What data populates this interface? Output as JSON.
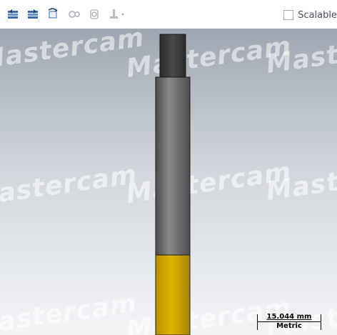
{
  "toolbar": {
    "buttons": [
      {
        "icon": "stack-left-icon"
      },
      {
        "icon": "stack-right-icon"
      },
      {
        "icon": "rotate-view-icon"
      },
      {
        "icon": "gear-pair-icon"
      },
      {
        "icon": "spindle-icon"
      },
      {
        "icon": "holder-dropdown-icon"
      }
    ],
    "scalable_label": "Scalable",
    "scalable_checked": false
  },
  "viewport": {
    "watermark_text": "Mastercam",
    "tool_colors": {
      "tip_shank": "#3a3a3a",
      "body": "#6d6d6d",
      "flute": "#d4a700"
    }
  },
  "scale": {
    "value": "15.044 mm",
    "unit": "Metric"
  }
}
